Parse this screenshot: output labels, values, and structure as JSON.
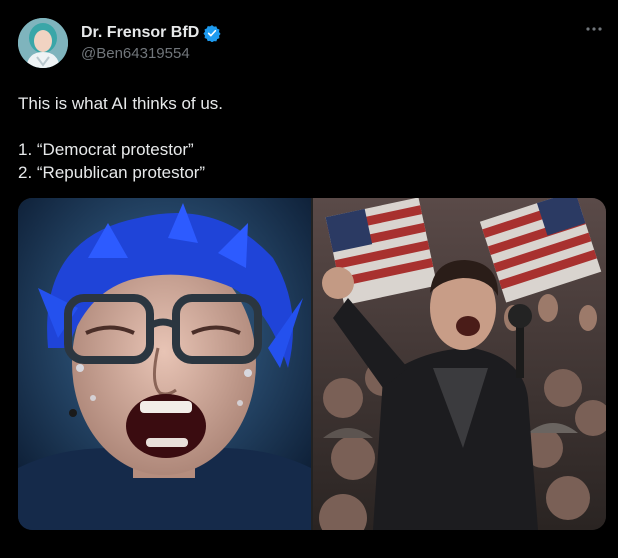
{
  "author": {
    "display_name": "Dr. Frensor BfD",
    "handle": "@Ben64319554",
    "verified_icon": "verified-badge-icon"
  },
  "tweet": {
    "text_line1": "This is what AI thinks of us.",
    "list": [
      "1. “Democrat protestor”",
      "2. “Republican protestor”"
    ]
  },
  "media": {
    "left_image": "crying-blue-haired-person",
    "right_image": "shouting-man-at-rally-with-flags"
  },
  "colors": {
    "background": "#000000",
    "text": "#e7e9ea",
    "secondary": "#71767b",
    "verified": "#1d9bf0"
  }
}
